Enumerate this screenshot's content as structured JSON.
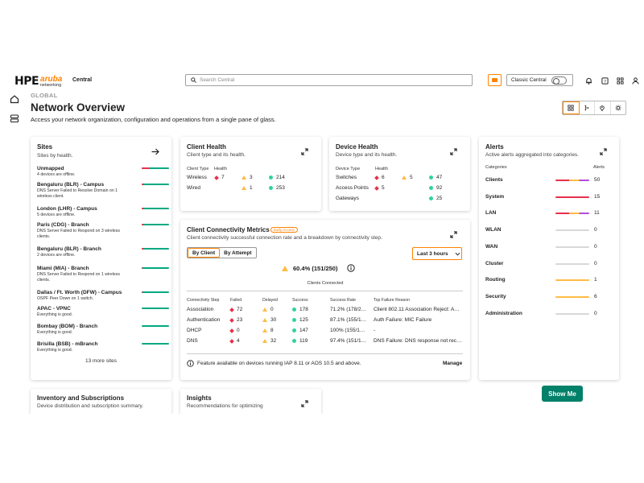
{
  "header": {
    "logo_hpe": "HPE",
    "logo_aruba": "aruba",
    "logo_networking": "networking",
    "app_name": "Central",
    "search_placeholder": "Search Central",
    "classic_label": "Classic Central",
    "accent": "#ff8300"
  },
  "page": {
    "scope": "GLOBAL",
    "title": "Network Overview",
    "subtitle": "Access your network organization, configuration and operations from a single pane of glass."
  },
  "sites": {
    "title": "Sites",
    "subtitle": "Sites by health.",
    "items": [
      {
        "name": "Unmapped",
        "desc": "4 devices are offline.",
        "red": 0.3
      },
      {
        "name": "Bengaluru (BLR) - Campus",
        "desc": "DNS Server Failed to Resolve Domain on 1 wireless client.",
        "red": 0.08
      },
      {
        "name": "London (LHR) - Campus",
        "desc": "5 devices are offline.",
        "red": 0.08
      },
      {
        "name": "Paris (CDG) - Branch",
        "desc": "DNS Server Failed to Respond on 3 wireless clients.",
        "red": 0.08
      },
      {
        "name": "Bengaluru (BLR) - Branch",
        "desc": "2 devices are offline.",
        "red": 0.1
      },
      {
        "name": "Miami (MIA) - Branch",
        "desc": "DNS Server Failed to Respond on 1 wireless clients.",
        "red": 0.04
      },
      {
        "name": "Dallas / Ft. Worth (DFW) - Campus",
        "desc": "OSPF Peer Down on 1 switch.",
        "red": 0.04
      },
      {
        "name": "APAC - VPNC",
        "desc": "Everything is good.",
        "red": 0
      },
      {
        "name": "Bombay (BOM) - Branch",
        "desc": "Everything is good.",
        "red": 0
      },
      {
        "name": "Brisilla (BSB) - mBranch",
        "desc": "Everything is good.",
        "red": 0
      }
    ],
    "more": "13 more sites"
  },
  "client_health": {
    "title": "Client Health",
    "subtitle": "Client type and its health.",
    "col_type": "Client Type",
    "col_health": "Health",
    "rows": [
      {
        "type": "Wireless",
        "red": "7",
        "amber": "3",
        "green": "214"
      },
      {
        "type": "Wired",
        "amber": "1",
        "green": "253"
      }
    ]
  },
  "device_health": {
    "title": "Device Health",
    "subtitle": "Device type and its health.",
    "col_type": "Device Type",
    "col_health": "Health",
    "rows": [
      {
        "type": "Switches",
        "red": "6",
        "amber": "5",
        "green": "47"
      },
      {
        "type": "Access Points",
        "red": "5",
        "green": "92"
      },
      {
        "type": "Gateways",
        "green": "25"
      }
    ]
  },
  "alerts": {
    "title": "Alerts",
    "subtitle": "Active alerts aggregated into categories.",
    "col_cat": "Categories",
    "col_alerts": "Alerts",
    "items": [
      {
        "name": "Clients",
        "count": "50",
        "colors": [
          "#e8304a",
          "#ffbc44",
          "#b44cd8"
        ]
      },
      {
        "name": "System",
        "count": "15",
        "colors": [
          "#e8304a"
        ]
      },
      {
        "name": "LAN",
        "count": "11",
        "colors": [
          "#e8304a",
          "#ffbc44",
          "#b44cd8"
        ]
      },
      {
        "name": "WLAN",
        "count": "0",
        "colors": []
      },
      {
        "name": "WAN",
        "count": "0",
        "colors": []
      },
      {
        "name": "Cluster",
        "count": "0",
        "colors": []
      },
      {
        "name": "Routing",
        "count": "1",
        "colors": [
          "#ffbc44"
        ]
      },
      {
        "name": "Security",
        "count": "6",
        "colors": [
          "#ffbc44"
        ]
      },
      {
        "name": "Administration",
        "count": "0",
        "colors": []
      }
    ]
  },
  "connectivity": {
    "title": "Client Connectivity Metrics",
    "badge": "Early Access",
    "subtitle": "Client connectivity successful connection rate and a breakdown by connectivity step.",
    "tab_client": "By Client",
    "tab_attempt": "By Attempt",
    "range": "Last 3 hours",
    "summary": "60.4% (151/250)",
    "summary_label": "Clients Connected",
    "columns": [
      "Connectivity Step",
      "Failed",
      "Delayed",
      "Success",
      "Success Rate",
      "Top Failure Reason"
    ],
    "rows": [
      {
        "step": "Association",
        "failed": "72",
        "delayed": "0",
        "success": "178",
        "rate": "71.2% (178/2…",
        "reason": "Client 802.11 Association Reject: A…"
      },
      {
        "step": "Authentication",
        "failed": "23",
        "delayed": "30",
        "success": "125",
        "rate": "87.1% (155/1…",
        "reason": "Auth Failure: MIC Failure"
      },
      {
        "step": "DHCP",
        "failed": "0",
        "delayed": "8",
        "success": "147",
        "rate": "100% (155/1…",
        "reason": "-"
      },
      {
        "step": "DNS",
        "failed": "4",
        "delayed": "32",
        "success": "119",
        "rate": "97.4% (151/1…",
        "reason": "DNS Failure: DNS response not rec…"
      }
    ],
    "footnote": "Feature available on devices running IAP 8.11 or AOS 10.5 and above.",
    "manage": "Manage"
  },
  "inventory": {
    "title": "Inventory and Subscriptions",
    "subtitle": "Device distribution and subscription summary."
  },
  "insights": {
    "title": "Insights",
    "subtitle": "Recommendations for optimizing"
  },
  "show_me": "Show Me"
}
